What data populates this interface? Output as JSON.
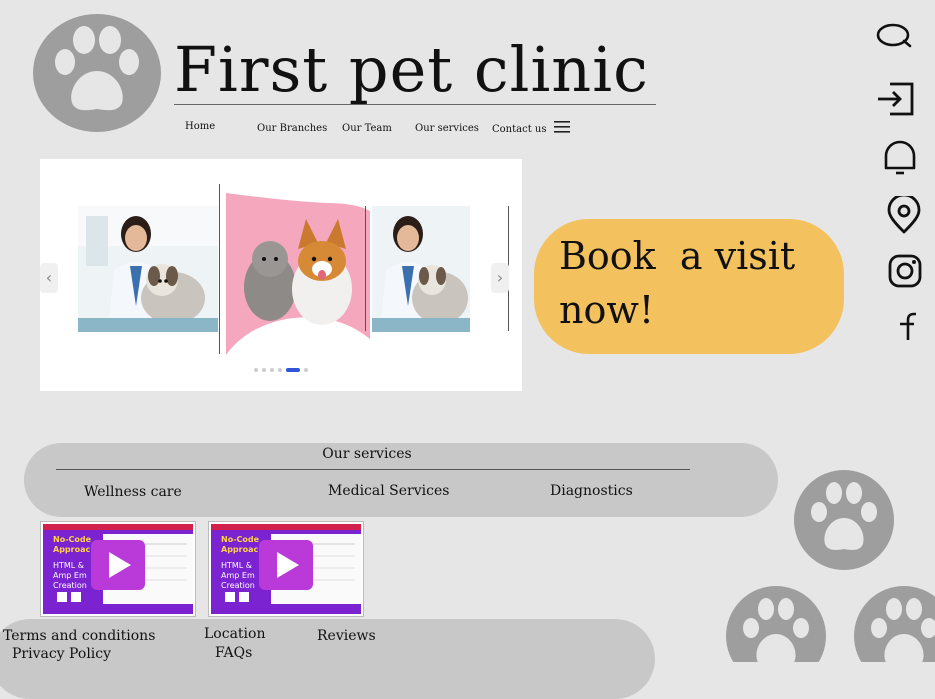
{
  "header": {
    "title": "First pet clinic",
    "nav": [
      "Home",
      "Our Branches",
      "Our Team",
      "Our services",
      "Contact us"
    ]
  },
  "hero": {
    "book_label": "Book  a visit now!",
    "dots_count": 6,
    "active_dot": 4
  },
  "side_icons": [
    "search-icon",
    "login-icon",
    "notification-bell-icon",
    "location-pin-icon",
    "instagram-icon",
    "facebook-icon"
  ],
  "services": {
    "heading": "Our services",
    "items": [
      "Wellness care",
      "Medical Services",
      "Diagnostics"
    ]
  },
  "videos": [
    {
      "thumb_text": [
        "No-Code",
        "Approac",
        "HTML &",
        "Amp Em",
        "Creation"
      ]
    },
    {
      "thumb_text": [
        "No-Code",
        "Approac",
        "HTML &",
        "Amp Em",
        "Creation"
      ]
    }
  ],
  "footer": {
    "terms": "Terms and conditions",
    "privacy": "Privacy Policy",
    "location": "Location",
    "faqs": "FAQs",
    "reviews": "Reviews"
  },
  "colors": {
    "background": "#e6e6e6",
    "accent": "#f3c25e",
    "panel": "#c8c8c8",
    "paw": "#9e9e9e",
    "active_dot": "#2f55d4",
    "video_purple": "#8a2bd8"
  }
}
